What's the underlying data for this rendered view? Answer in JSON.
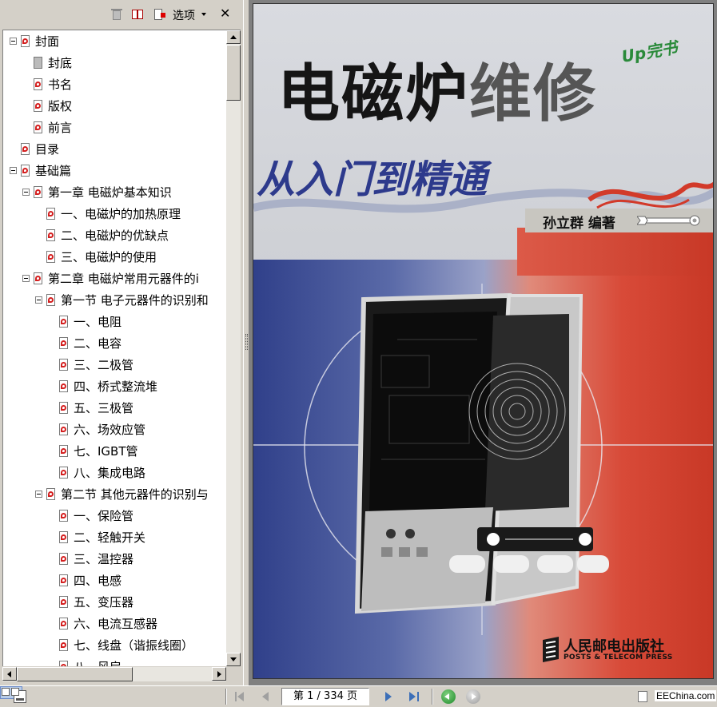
{
  "panel_toolbar": {
    "options_label": "选项"
  },
  "bookmarks": [
    {
      "label": "封面"
    },
    {
      "label": "封底"
    },
    {
      "label": "书名"
    },
    {
      "label": "版权"
    },
    {
      "label": "前言"
    },
    {
      "label": "目录"
    },
    {
      "label": "基础篇"
    },
    {
      "label": "第一章  电磁炉基本知识"
    },
    {
      "label": "一、电磁炉的加热原理"
    },
    {
      "label": "二、电磁炉的优缺点"
    },
    {
      "label": "三、电磁炉的使用"
    },
    {
      "label": "第二章  电磁炉常用元器件的i"
    },
    {
      "label": "第一节  电子元器件的识别和"
    },
    {
      "label": "一、电阻"
    },
    {
      "label": "二、电容"
    },
    {
      "label": "三、二极管"
    },
    {
      "label": "四、桥式整流堆"
    },
    {
      "label": "五、三极管"
    },
    {
      "label": "六、场效应管"
    },
    {
      "label": "七、IGBT管"
    },
    {
      "label": "八、集成电路"
    },
    {
      "label": "第二节  其他元器件的识别与"
    },
    {
      "label": "一、保险管"
    },
    {
      "label": "二、轻触开关"
    },
    {
      "label": "三、温控器"
    },
    {
      "label": "四、电感"
    },
    {
      "label": "五、变压器"
    },
    {
      "label": "六、电流互感器"
    },
    {
      "label": "七、线盘（谐振线圈）"
    },
    {
      "label": "八、风扇"
    }
  ],
  "cover": {
    "title_dark": "电磁炉",
    "title_gray": "维修",
    "badge": "Up完书",
    "subtitle": "从入门到精通",
    "author": "孙立群 编著",
    "publisher_cn": "人民邮电出版社",
    "publisher_en": "POSTS & TELECOM PRESS",
    "colors": {
      "blue": "#30408a",
      "red": "#c83826",
      "subtitle": "#2d3a8c"
    }
  },
  "statusbar": {
    "page_indicator": "第 1 / 334 页",
    "watermark": "EEChina.com"
  },
  "icons": [
    "delete-icon",
    "bookmark-icon",
    "new-bookmark-icon",
    "close-icon",
    "first-page-icon",
    "prev-page-icon",
    "next-page-icon",
    "last-page-icon",
    "go-back-icon",
    "go-forward-icon"
  ]
}
